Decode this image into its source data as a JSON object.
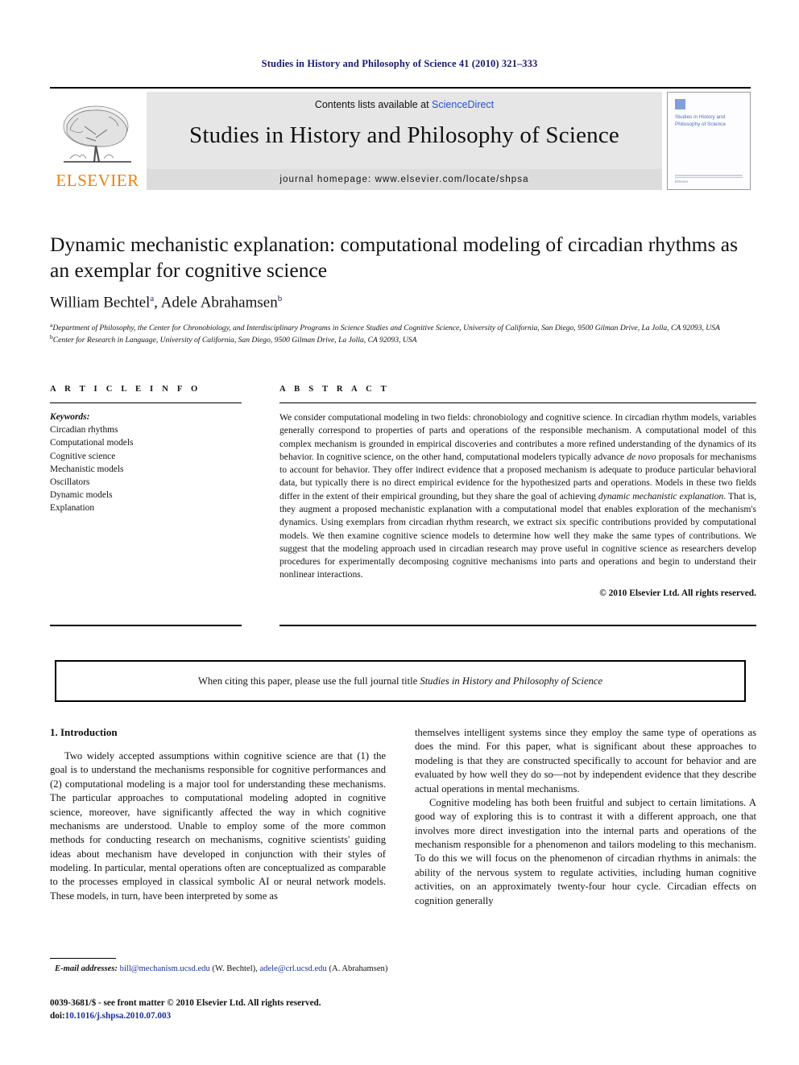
{
  "running_head": "Studies in History and Philosophy of Science 41 (2010) 321–333",
  "masthead": {
    "publisher_logo_label": "ELSEVIER",
    "contents_prefix": "Contents lists available at ",
    "contents_link": "ScienceDirect",
    "journal_title": "Studies in History and Philosophy of Science",
    "homepage_line": "journal homepage: www.elsevier.com/locate/shpsa",
    "cover": {
      "title": "Studies in History and Philosophy of Science",
      "footer": "Elsevier"
    }
  },
  "article": {
    "title": "Dynamic mechanistic explanation: computational modeling of circadian rhythms as an exemplar for cognitive science",
    "authors": "William Bechtel",
    "author_one": "William Bechtel",
    "author_one_mark": "a",
    "author_two": ", Adele Abrahamsen",
    "author_two_mark": "b",
    "affiliation_a_mark": "a",
    "affiliation_a": "Department of Philosophy, the Center for Chronobiology, and Interdisciplinary Programs in Science Studies and Cognitive Science, University of California, San Diego, 9500 Gilman Drive, La Jolla, CA 92093, USA",
    "affiliation_b_mark": "b",
    "affiliation_b": "Center for Research in Language, University of California, San Diego, 9500 Gilman Drive, La Jolla, CA 92093, USA"
  },
  "article_info": {
    "heading": "A R T I C L E   I N F O",
    "keywords_label": "Keywords:",
    "keywords": [
      "Circadian rhythms",
      "Computational models",
      "Cognitive science",
      "Mechanistic models",
      "Oscillators",
      "Dynamic models",
      "Explanation"
    ]
  },
  "abstract": {
    "heading": "A B S T R A C T",
    "part1": "We consider computational modeling in two fields: chronobiology and cognitive science. In circadian rhythm models, variables generally correspond to properties of parts and operations of the responsible mechanism. A computational model of this complex mechanism is grounded in empirical discoveries and contributes a more refined understanding of the dynamics of its behavior. In cognitive science, on the other hand, computational modelers typically advance ",
    "italic1": "de novo",
    "part2": " proposals for mechanisms to account for behavior. They offer indirect evidence that a proposed mechanism is adequate to produce particular behavioral data, but typically there is no direct empirical evidence for the hypothesized parts and operations. Models in these two fields differ in the extent of their empirical grounding, but they share the goal of achieving ",
    "italic2": "dynamic mechanistic explanation",
    "part3": ". That is, they augment a proposed mechanistic explanation with a computational model that enables exploration of the mechanism's dynamics. Using exemplars from circadian rhythm research, we extract six specific contributions provided by computational models. We then examine cognitive science models to determine how well they make the same types of contributions. We suggest that the modeling approach used in circadian research may prove useful in cognitive science as researchers develop procedures for experimentally decomposing cognitive mechanisms into parts and operations and begin to understand their nonlinear interactions.",
    "copyright": "© 2010 Elsevier Ltd. All rights reserved."
  },
  "citation_notice": {
    "prefix": "When citing this paper, please use the full journal title ",
    "journal": "Studies in History and Philosophy of Science"
  },
  "body": {
    "section_number_title": "1. Introduction",
    "left_paragraphs": [
      "Two widely accepted assumptions within cognitive science are that (1) the goal is to understand the mechanisms responsible for cognitive performances and (2) computational modeling is a major tool for understanding these mechanisms. The particular approaches to computational modeling adopted in cognitive science, moreover, have significantly affected the way in which cognitive mechanisms are understood. Unable to employ some of the more common methods for conducting research on mechanisms, cognitive scientists' guiding ideas about mechanism have developed in conjunction with their styles of modeling. In particular, mental operations often are conceptualized as comparable to the processes employed in classical symbolic AI or neural network models. These models, in turn, have been interpreted by some as"
    ],
    "right_paragraphs": [
      "themselves intelligent systems since they employ the same type of operations as does the mind. For this paper, what is significant about these approaches to modeling is that they are constructed specifically to account for behavior and are evaluated by how well they do so—not by independent evidence that they describe actual operations in mental mechanisms.",
      "Cognitive modeling has both been fruitful and subject to certain limitations. A good way of exploring this is to contrast it with a different approach, one that involves more direct investigation into the internal parts and operations of the mechanism responsible for a phenomenon and tailors modeling to this mechanism. To do this we will focus on the phenomenon of circadian rhythms in animals: the ability of the nervous system to regulate activities, including human cognitive activities, on an approximately twenty-four hour cycle. Circadian effects on cognition generally"
    ]
  },
  "footer": {
    "email_label": "E-mail addresses:",
    "email_one": "bill@mechanism.ucsd.edu",
    "email_one_owner": " (W. Bechtel), ",
    "email_two": "adele@crl.ucsd.edu",
    "email_two_owner": " (A. Abrahamsen)",
    "issn_line": "0039-3681/$ - see front matter © 2010 Elsevier Ltd. All rights reserved.",
    "doi_label": "doi:",
    "doi_value": "10.1016/j.shpsa.2010.07.003"
  },
  "colors": {
    "running_head": "#1a1a6e",
    "link": "#2b4fd0",
    "elsevier_orange": "#F07F13",
    "band_gray": "#e6e6e6",
    "strip_gray": "#dcdcdc"
  }
}
